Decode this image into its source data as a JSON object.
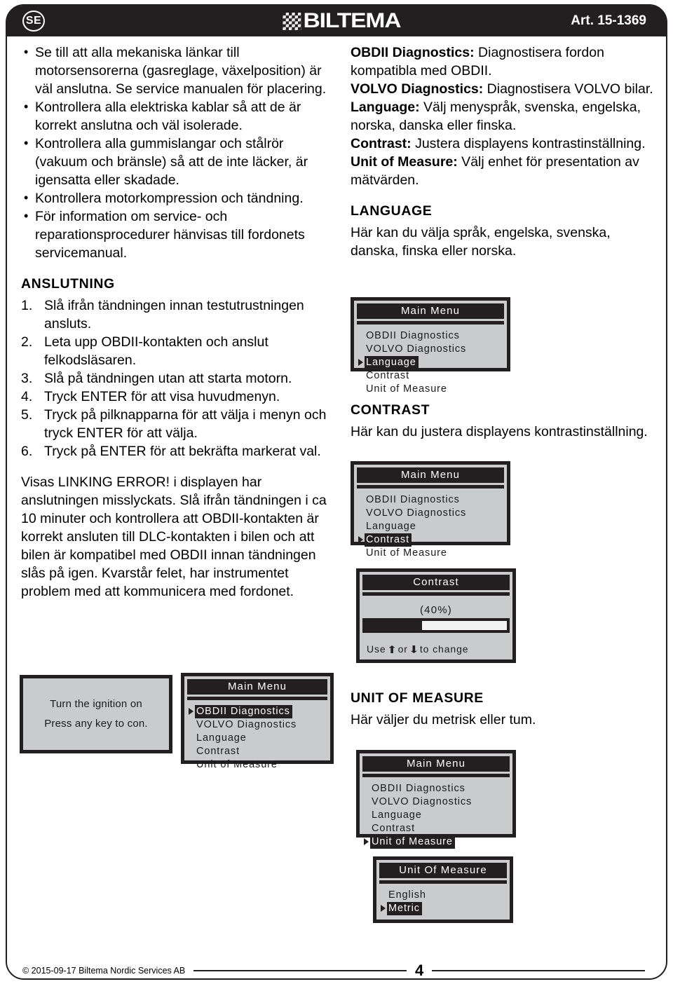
{
  "header": {
    "locale_badge": "SE",
    "brand": "BILTEMA",
    "article": "Art. 15-1369"
  },
  "left_column": {
    "bullets": [
      "Se till att alla mekaniska länkar till motorsensorerna (gasreglage, växelposition) är väl anslutna. Se service manualen för placering.",
      "Kontrollera alla elektriska kablar så att de är korrekt anslutna och väl isolerade.",
      "Kontrollera alla gummislangar och stålrör (vakuum och bränsle) så att de inte läcker, är igensatta eller skadade.",
      "Kontrollera motorkompression och tändning.",
      "För information om service- och reparationsprocedurer hänvisas till fordonets servicemanual."
    ],
    "anslutning_heading": "ANSLUTNING",
    "steps": [
      "Slå ifrån tändningen innan testutrustningen ansluts.",
      "Leta upp OBDII-kontakten och anslut felkodsläsaren.",
      "Slå på tändningen utan att starta motorn.",
      "Tryck ENTER för att visa huvudmenyn.",
      "Tryck på pilknapparna för att välja i menyn och tryck ENTER för att välja.",
      "Tryck på ENTER för att bekräfta markerat val."
    ],
    "linking_error_paragraph": "Visas LINKING ERROR! i displayen har anslutningen misslyckats. Slå ifrån tändningen i ca 10 minuter och kontrollera att OBDII-kontakten är korrekt ansluten till DLC-kontakten i bilen och att bilen är kompatibel med OBDII innan tändningen slås på igen. Kvarstår felet, har instrumentet problem med att kommunicera med fordonet."
  },
  "right_column": {
    "definitions": [
      {
        "term": "OBDII Diagnostics:",
        "desc": " Diagnostisera fordon kompatibla med OBDII."
      },
      {
        "term": "VOLVO Diagnostics:",
        "desc": " Diagnostisera VOLVO bilar."
      },
      {
        "term": "Language:",
        "desc": " Välj menyspråk, svenska, engelska, norska, danska eller finska."
      },
      {
        "term": "Contrast:",
        "desc": " Justera displayens kontrastinställning."
      },
      {
        "term": "Unit of Measure:",
        "desc": " Välj enhet för presentation av mätvärden."
      }
    ],
    "language_heading": "LANGUAGE",
    "language_text": "Här kan du välja språk, engelska, svenska, danska, finska eller norska.",
    "contrast_heading": "CONTRAST",
    "contrast_text": "Här kan du justera displayens kontrastinställning.",
    "uom_heading": "UNIT OF MEASURE",
    "uom_text": "Här väljer du metrisk eller tum."
  },
  "screens": {
    "ignition": {
      "line1": "Turn the ignition on",
      "line2": "Press any key to con."
    },
    "main_menu_title": "Main Menu",
    "menu_items": [
      "OBDII Diagnostics",
      "VOLVO Diagnostics",
      "Language",
      "Contrast",
      "Unit of Measure"
    ],
    "contrast_screen": {
      "title": "Contrast",
      "percent_label": "(40%)",
      "percent_value": 40,
      "hint_prefix": "Use",
      "hint_mid": "or",
      "hint_suffix": "to change"
    },
    "uom_screen": {
      "title": "Unit Of Measure",
      "options": [
        "English",
        "Metric"
      ],
      "selected": "Metric"
    }
  },
  "footer": {
    "copyright": "© 2015-09-17 Biltema Nordic Services AB",
    "page": "4"
  }
}
